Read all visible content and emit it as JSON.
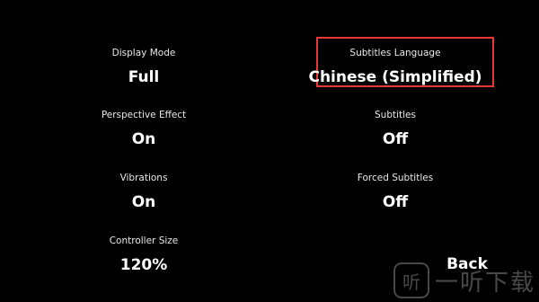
{
  "settings": {
    "display_mode": {
      "label": "Display Mode",
      "value": "Full"
    },
    "perspective_effect": {
      "label": "Perspective Effect",
      "value": "On"
    },
    "vibrations": {
      "label": "Vibrations",
      "value": "On"
    },
    "controller_size": {
      "label": "Controller Size",
      "value": "120%"
    },
    "subtitles_language": {
      "label": "Subtitles Language",
      "value": "Chinese (Simplified)"
    },
    "subtitles": {
      "label": "Subtitles",
      "value": "Off"
    },
    "forced_subtitles": {
      "label": "Forced Subtitles",
      "value": "Off"
    }
  },
  "navigation": {
    "back_label": "Back"
  },
  "watermark": {
    "text": "一听下载",
    "logo_glyph": "听"
  },
  "colors": {
    "background": "#000000",
    "text": "#ffffff",
    "highlight_border": "#e53935"
  }
}
